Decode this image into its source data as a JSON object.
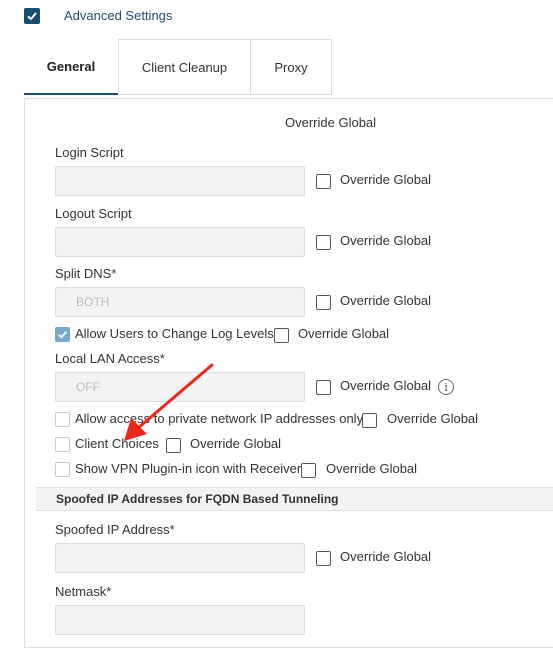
{
  "header": {
    "title": "Advanced Settings",
    "checked": true
  },
  "tabs": [
    {
      "label": "General",
      "active": true
    },
    {
      "label": "Client Cleanup",
      "active": false
    },
    {
      "label": "Proxy",
      "active": false
    }
  ],
  "general": {
    "override_global_header": "Override Global",
    "override_label": "Override Global",
    "login_script": {
      "label": "Login Script",
      "value": ""
    },
    "logout_script": {
      "label": "Logout Script",
      "value": ""
    },
    "split_dns": {
      "label": "Split DNS*",
      "value": "BOTH"
    },
    "allow_log_levels": {
      "label": "Allow Users to Change Log Levels",
      "checked": true
    },
    "local_lan_access": {
      "label": "Local LAN Access*",
      "value": "OFF"
    },
    "allow_private_ip": {
      "label": "Allow access to private network IP addresses only",
      "checked": false
    },
    "client_choices": {
      "label": "Client Choices",
      "checked": false
    },
    "show_vpn_plugin": {
      "label": "Show VPN Plugin-in icon with Receiver",
      "checked": false
    }
  },
  "spoofed_section": {
    "title": "Spoofed IP Addresses for FQDN Based Tunneling",
    "spoofed_ip": {
      "label": "Spoofed IP Address*",
      "value": ""
    },
    "netmask": {
      "label": "Netmask*",
      "value": ""
    }
  },
  "colors": {
    "accent": "#1a4e6e",
    "checked_light": "#77a8c9",
    "arrow": "#e8291c"
  },
  "icons": {
    "info": "info-icon",
    "arrow": "red-arrow-annotation"
  }
}
